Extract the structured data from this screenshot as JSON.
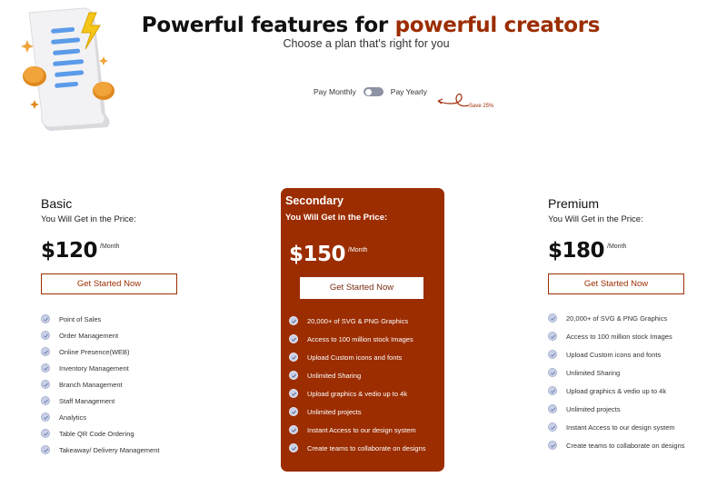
{
  "header": {
    "title_part1": "Powerful features for",
    "title_accent": "powerful creators",
    "subtitle": "Choose a plan that's right for you"
  },
  "billing": {
    "monthly_label": "Pay Monthly",
    "yearly_label": "Pay Yearly",
    "save_note": "Save 25%",
    "selected": "monthly"
  },
  "colors": {
    "accent": "#9b2d00",
    "check_bg": "#c9d1e8"
  },
  "plans": [
    {
      "name": "Basic",
      "subtitle": "You Will Get in the Price:",
      "price": "$120",
      "period": "/Month",
      "cta": "Get Started Now",
      "features": [
        "Point of Sales",
        "Order Management",
        "Online Presence(WEB)",
        "Inventory Management",
        "Branch Management",
        "Staff Management",
        "Analytics",
        "Table QR Code Ordering",
        "Takeaway/ Delivery Management"
      ]
    },
    {
      "name": "Secondary",
      "subtitle": "You Will Get in the Price:",
      "price": "$150",
      "period": "/Month",
      "cta": "Get Started Now",
      "features": [
        "20,000+ of SVG & PNG Graphics",
        "Access to 100 million stock Images",
        "Upload Custom icons and fonts",
        "Unlimited Sharing",
        "Upload graphics & vedio up to 4k",
        "Unlimited projects",
        "Instant Access to our design system",
        "Create teams to collaborate on designs"
      ]
    },
    {
      "name": "Premium",
      "subtitle": "You Will Get in the Price:",
      "price": "$180",
      "period": "/Month",
      "cta": "Get Started Now",
      "features": [
        "20,000+ of SVG & PNG Graphics",
        "Access to 100 million stock Images",
        "Upload Custom icons and fonts",
        "Unlimited Sharing",
        "Upload graphics & vedio up to 4k",
        "Unlimited projects",
        "Instant Access to our design system",
        "Create teams to collaborate on designs"
      ]
    }
  ],
  "icons": {
    "feature_check": "check-circle-icon",
    "hero": "receipt-coins-illustration"
  }
}
